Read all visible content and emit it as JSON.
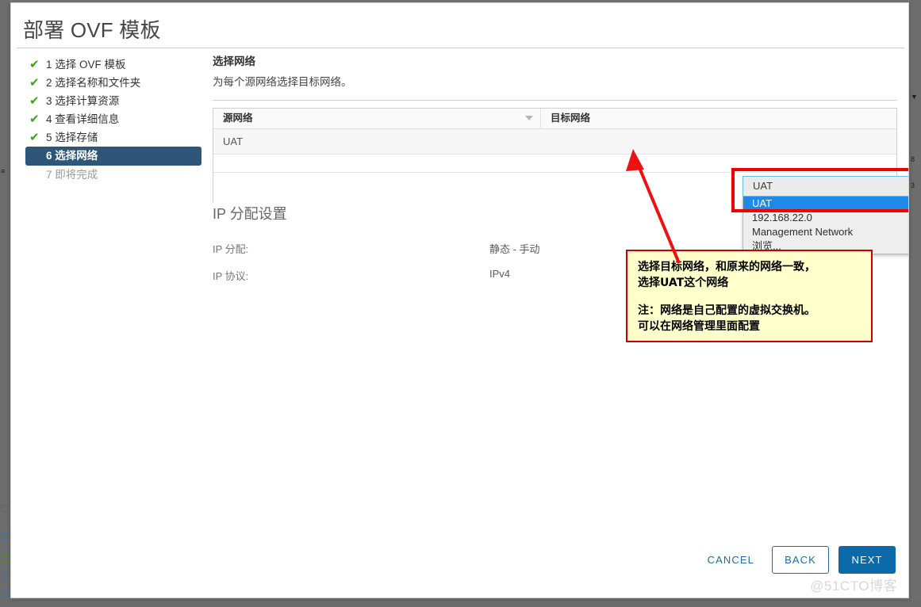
{
  "window": {
    "title": "部署 OVF 模板"
  },
  "steps": [
    {
      "num": "1",
      "label": "选择 OVF 模板",
      "state": "done"
    },
    {
      "num": "2",
      "label": "选择名称和文件夹",
      "state": "done"
    },
    {
      "num": "3",
      "label": "选择计算资源",
      "state": "done"
    },
    {
      "num": "4",
      "label": "查看详细信息",
      "state": "done"
    },
    {
      "num": "5",
      "label": "选择存储",
      "state": "done"
    },
    {
      "num": "6",
      "label": "选择网络",
      "state": "current"
    },
    {
      "num": "7",
      "label": "即将完成",
      "state": "pending"
    }
  ],
  "section": {
    "title": "选择网络",
    "subtitle": "为每个源网络选择目标网络。"
  },
  "networks_table": {
    "columns": [
      "源网络",
      "目标网络"
    ],
    "rows": [
      {
        "source": "UAT",
        "destination": "UAT"
      }
    ]
  },
  "destination_select": {
    "value": "UAT",
    "options": [
      "UAT",
      "192.168.22.0",
      "Management Network",
      "浏览..."
    ],
    "selected_index": 0,
    "expanded": true
  },
  "ip_allocation": {
    "title": "IP 分配设置",
    "rows": [
      {
        "label": "IP 分配:",
        "value": "静态 - 手动"
      },
      {
        "label": "IP 协议:",
        "value": "IPv4"
      }
    ]
  },
  "annotation": {
    "line1": "选择目标网络，和原来的网络一致，\n选择UAT这个网络",
    "line2": "注：网络是自己配置的虚拟交换机。\n可以在网络管理里面配置",
    "border_color": "#cc0000",
    "fill_color": "#ffffcc"
  },
  "highlight": {
    "color": "#f20000"
  },
  "footer": {
    "cancel": "CANCEL",
    "back": "BACK",
    "next": "NEXT"
  },
  "watermark": {
    "text": "@51CTO博客"
  }
}
